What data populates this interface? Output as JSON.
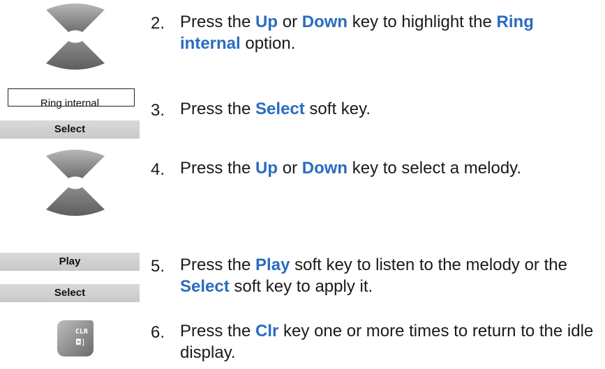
{
  "steps": [
    {
      "number": "2.",
      "parts": [
        {
          "t": "Press the "
        },
        {
          "t": "Up",
          "kw": true
        },
        {
          "t": " or "
        },
        {
          "t": "Down",
          "kw": true
        },
        {
          "t": " key to highlight the "
        },
        {
          "t": "Ring internal",
          "kw": true
        },
        {
          "t": " option."
        }
      ]
    },
    {
      "number": "3.",
      "parts": [
        {
          "t": "Press the "
        },
        {
          "t": "Select",
          "kw": true
        },
        {
          "t": " soft key."
        }
      ]
    },
    {
      "number": "4.",
      "parts": [
        {
          "t": "Press the "
        },
        {
          "t": "Up",
          "kw": true
        },
        {
          "t": " or "
        },
        {
          "t": "Down",
          "kw": true
        },
        {
          "t": " key to select a melody."
        }
      ]
    },
    {
      "number": "5.",
      "parts": [
        {
          "t": "Press the "
        },
        {
          "t": "Play",
          "kw": true
        },
        {
          "t": " soft key to listen to the melody or the "
        },
        {
          "t": "Select",
          "kw": true
        },
        {
          "t": " soft key to apply it."
        }
      ]
    },
    {
      "number": "6.",
      "parts": [
        {
          "t": "Press the "
        },
        {
          "t": "Clr",
          "kw": true
        },
        {
          "t": " key one or more times to return to the idle display."
        }
      ]
    }
  ],
  "display_label": "Ring internal",
  "softkeys": {
    "select_1": "Select",
    "play": "Play",
    "select_2": "Select"
  },
  "clr_key": {
    "line1": "CLR",
    "line2": "◘]"
  },
  "colors": {
    "keyword": "#2a6cc0",
    "softkey_bg": "#d0d0d0",
    "nav_key": "#8f8f8f"
  }
}
